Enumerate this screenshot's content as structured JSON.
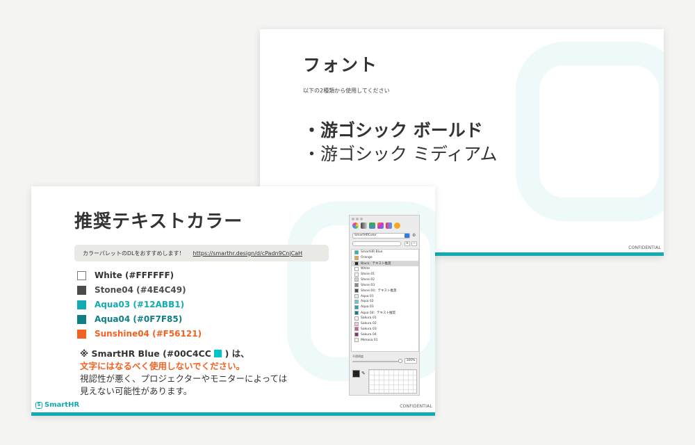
{
  "font_slide": {
    "title": "フォント",
    "subtitle": "以下の2種類から使用してください",
    "fonts": [
      "・游ゴシック ボールド",
      "・游ゴシック ミディアム"
    ],
    "confidential": "CONFIDENTIAL"
  },
  "color_slide": {
    "title": "推奨テキストカラー",
    "palette_note": "カラーパレットのDLをおすすめします！",
    "palette_link": "https://smarthr.design/d/cPadn9CnjCaH",
    "colors": [
      {
        "label": "White (#FFFFFF)",
        "color": "#FFFFFF",
        "text_color": "#333333"
      },
      {
        "label": "Stone04 (#4E4C49)",
        "color": "#4E4C49",
        "text_color": "#4E4C49"
      },
      {
        "label": "Aqua03 (#12ABB1)",
        "color": "#12ABB1",
        "text_color": "#12ABB1"
      },
      {
        "label": "Aqua04 (#0F7F85)",
        "color": "#0F7F85",
        "text_color": "#0F7F85"
      },
      {
        "label": "Sunshine04 (#F56121)",
        "color": "#F56121",
        "text_color": "#F56121"
      }
    ],
    "warning_prefix": "※ SmartHR Blue (#00C4CC",
    "warning_suffix": ") は、",
    "warning_emphasis": "文字にはなるべく使用しないでください。",
    "warning_line3": "視認性が悪く、プロジェクターやモニターによっては",
    "warning_line4": "見えない可能性があります。",
    "logo_text": "SmartHR",
    "logo_mark": "S",
    "confidential": "CONFIDENTIAL"
  },
  "color_picker": {
    "palette_name": "SmartHRColor",
    "opacity_label": "不透明度",
    "opacity_value": "100%",
    "add_label": "+",
    "remove_label": "−",
    "entries": [
      {
        "label": "SmartHR Blue",
        "color": "#00C4CC"
      },
      {
        "label": "Orange",
        "color": "#F5A623"
      },
      {
        "label": "Black：テキスト推奨",
        "color": "#222222",
        "selected": true
      },
      {
        "label": "White",
        "color": "#FFFFFF"
      },
      {
        "label": "Stone 01",
        "color": "#F8F7F6"
      },
      {
        "label": "Stone 02",
        "color": "#D6D3D0"
      },
      {
        "label": "Stone 03",
        "color": "#8A8885"
      },
      {
        "label": "Stone 04：テキスト推奨",
        "color": "#4E4C49"
      },
      {
        "label": "Aqua 01",
        "color": "#D6F3F4"
      },
      {
        "label": "Aqua 02",
        "color": "#5FCFD3"
      },
      {
        "label": "Aqua 03",
        "color": "#12ABB1"
      },
      {
        "label": "Aqua 04：テキスト推奨",
        "color": "#0F7F85"
      },
      {
        "label": "Sakura 01",
        "color": "#FCEFF4"
      },
      {
        "label": "Sakura 02",
        "color": "#F5C6D6"
      },
      {
        "label": "Sakura 03",
        "color": "#D658A1"
      },
      {
        "label": "Sakura 04",
        "color": "#8F2F6B"
      },
      {
        "label": "Mimosa 01",
        "color": "#FFF5CC"
      }
    ]
  }
}
